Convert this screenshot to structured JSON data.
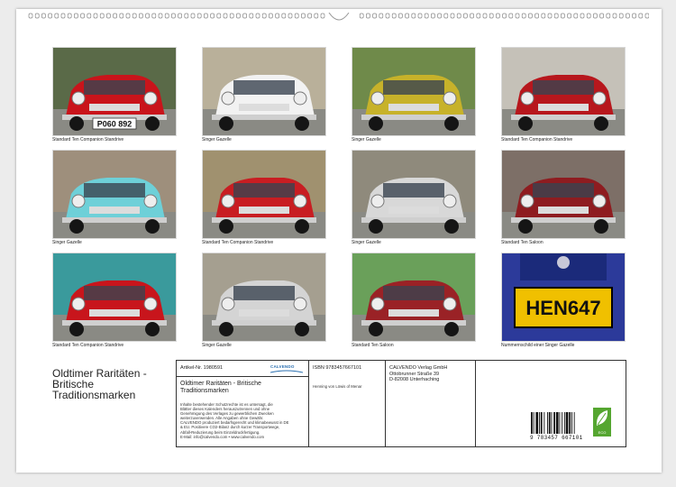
{
  "calendar": {
    "title_lines": [
      "Oldtimer Raritäten -",
      "Britische",
      "Traditionsmarken"
    ]
  },
  "photos": [
    {
      "caption": "Standard Ten Companion Standrive",
      "plate": "P060 892",
      "body": "#c9141b",
      "bg": "#5a6a48"
    },
    {
      "caption": "Singer Gazelle",
      "body": "#f2f2f2",
      "bg": "#b9b09a"
    },
    {
      "caption": "Singer Gazelle",
      "body": "#c7b22a",
      "bg": "#6f8a4a"
    },
    {
      "caption": "Standard Ten Companion Standrive",
      "body": "#b7171d",
      "bg": "#c5c1b8"
    },
    {
      "caption": "Singer Gazelle",
      "body": "#6ed0d8",
      "bg": "#9e8f7c"
    },
    {
      "caption": "Standard Ten Companion Standrive",
      "body": "#c81d22",
      "bg": "#a0916f"
    },
    {
      "caption": "Singer Gazelle",
      "body": "#d8d8d8",
      "bg": "#8f8a7c"
    },
    {
      "caption": "Standard Ten Saloon",
      "body": "#8e1c20",
      "bg": "#7d6f67"
    },
    {
      "caption": "Standard Ten Companion Standrive",
      "body": "#c8151c",
      "bg": "#3a9a9c"
    },
    {
      "caption": "Singer Gazelle",
      "body": "#d4d4d4",
      "bg": "#a59f90"
    },
    {
      "caption": "Standard Ten Saloon",
      "body": "#9a2226",
      "bg": "#6aa05a"
    },
    {
      "caption": "Nummernschild einer Singer Gazelle",
      "plate": "HEN647",
      "body": "#1a2a8a",
      "bg": "#f0c000"
    }
  ],
  "info": {
    "article": "Artikel-Nr. 1980591",
    "isbn": "ISBN 9783457667101",
    "publisher_lines": [
      "CALVENDO Verlag GmbH",
      "Ottobrunner Straße 39",
      "D-82008 Unterhaching"
    ],
    "author": "Henning von Löwis of Menar",
    "title_lines": [
      "Oldtimer Raritäten - Britische",
      "Traditionsmarken"
    ],
    "legal_lines": [
      "Inhalte bestehender Schutzrechte ist es untersagt, die",
      "Blätter dieses Kalenders herauszutrennen und ohne",
      "Genehmigung des Verlages zu gewerblichen Zwecken",
      "weiterzuverwenden. Alle Angaben ohne Gewähr.",
      "CALVENDO produziert bedarfsgerecht und klimabewusst in DE",
      "& EU. Positivere CO2-Bilanz durch kurzer Transportwege,",
      "Abfall-Reduzierung beim Einzeldruckfertigung.",
      "E-Mail: info@calvendo.com • www.calvendo.com"
    ],
    "logo": "CALVENDO",
    "barcode_number": "9 783457 667101",
    "eco_label": "ECO"
  }
}
